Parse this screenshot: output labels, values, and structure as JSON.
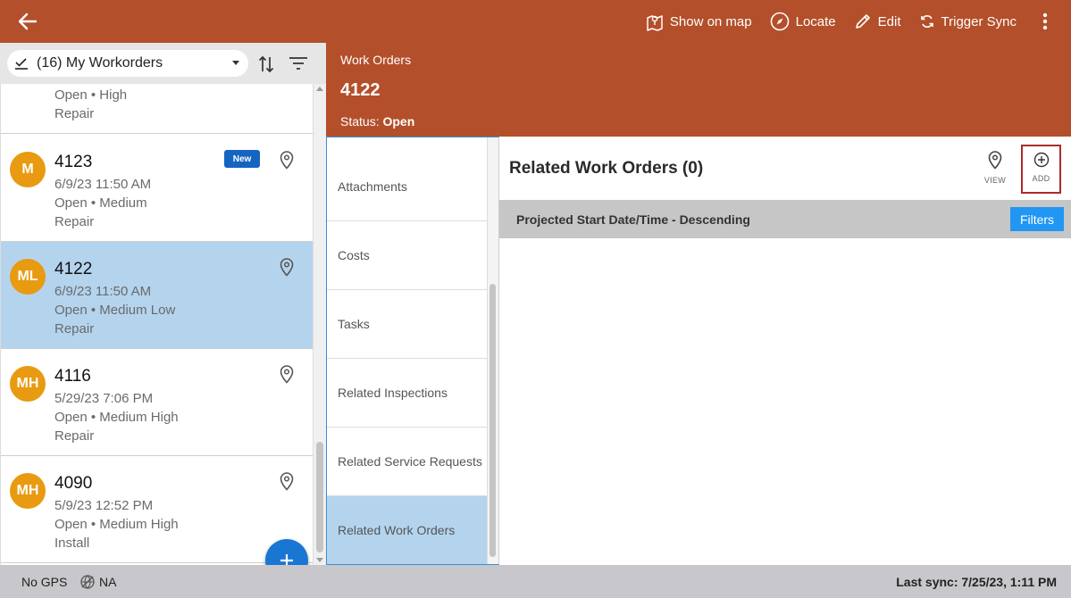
{
  "topbar": {
    "actions": {
      "show_on_map": "Show on map",
      "locate": "Locate",
      "edit": "Edit",
      "trigger_sync": "Trigger Sync"
    },
    "color": "#b34f2a"
  },
  "list": {
    "selector_label": "(16) My Workorders",
    "items": [
      {
        "avatar": "",
        "number": "",
        "date": "",
        "status": "Open • High",
        "type": "Repair",
        "badge": ""
      },
      {
        "avatar": "M",
        "number": "4123",
        "date": "6/9/23 11:50 AM",
        "status": "Open • Medium",
        "type": "Repair",
        "badge": "New"
      },
      {
        "avatar": "ML",
        "number": "4122",
        "date": "6/9/23 11:50 AM",
        "status": "Open • Medium Low",
        "type": "Repair",
        "badge": ""
      },
      {
        "avatar": "MH",
        "number": "4116",
        "date": "5/29/23 7:06 PM",
        "status": "Open • Medium High",
        "type": "Repair",
        "badge": ""
      },
      {
        "avatar": "MH",
        "number": "4090",
        "date": "5/9/23 12:52 PM",
        "status": "Open • Medium High",
        "type": "Install",
        "badge": ""
      }
    ]
  },
  "detail": {
    "breadcrumb": "Work Orders",
    "title": "4122",
    "status_label": "Status:",
    "status_value": "Open"
  },
  "sections": [
    {
      "label": "Attachments"
    },
    {
      "label": "Costs"
    },
    {
      "label": "Tasks"
    },
    {
      "label": "Related Inspections"
    },
    {
      "label": "Related Service Requests"
    },
    {
      "label": "Related Work Orders"
    }
  ],
  "content": {
    "heading": "Related Work Orders (0)",
    "view_label": "VIEW",
    "add_label": "ADD",
    "sort_label": "Projected Start Date/Time - Descending",
    "filters_label": "Filters"
  },
  "footer": {
    "gps": "No GPS",
    "network": "NA",
    "last_sync": "Last sync: 7/25/23, 1:11 PM"
  }
}
